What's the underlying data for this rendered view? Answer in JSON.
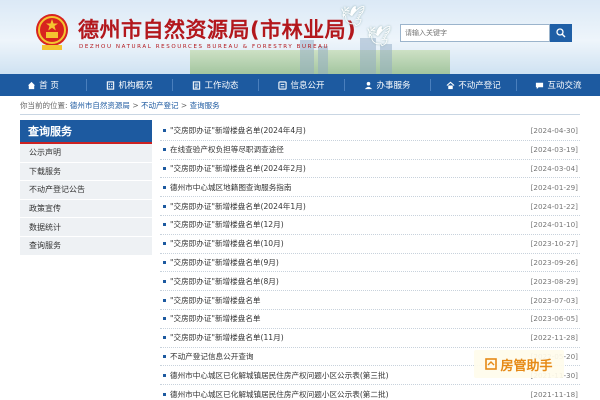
{
  "header": {
    "title": "德州市自然资源局(市林业局)",
    "subtitle": "DEZHOU NATURAL RESOURCES BUREAU & FORESTRY BUREAU",
    "search_placeholder": "请输入关键字"
  },
  "nav": {
    "items": [
      {
        "label": "首 页",
        "icon": "home-icon"
      },
      {
        "label": "机构概况",
        "icon": "building-icon"
      },
      {
        "label": "工作动态",
        "icon": "document-icon"
      },
      {
        "label": "信息公开",
        "icon": "info-list-icon"
      },
      {
        "label": "办事服务",
        "icon": "service-icon"
      },
      {
        "label": "不动产登记",
        "icon": "property-icon"
      },
      {
        "label": "互动交流",
        "icon": "chat-icon"
      }
    ]
  },
  "breadcrumb": {
    "prefix": "你当前的位置:",
    "items": [
      "德州市自然资源局",
      "不动产登记",
      "查询服务"
    ],
    "separator": ">"
  },
  "sidebar": {
    "title": "查询服务",
    "items": [
      "公示声明",
      "下载服务",
      "不动产登记公告",
      "政策宣传",
      "数据统计",
      "查询服务"
    ]
  },
  "list": {
    "rows": [
      {
        "title": "\"交房即办证\"新增楼盘名单(2024年4月)",
        "date": "[2024-04-30]"
      },
      {
        "title": "在线查验产权负担等尽职调查途径",
        "date": "[2024-03-19]"
      },
      {
        "title": "\"交房即办证\"新增楼盘名单(2024年2月)",
        "date": "[2024-03-04]"
      },
      {
        "title": "德州市中心城区地籍图查询服务指南",
        "date": "[2024-01-29]"
      },
      {
        "title": "\"交房即办证\"新增楼盘名单(2024年1月)",
        "date": "[2024-01-22]"
      },
      {
        "title": "\"交房即办证\"新增楼盘名单(12月)",
        "date": "[2024-01-10]"
      },
      {
        "title": "\"交房即办证\"新增楼盘名单(10月)",
        "date": "[2023-10-27]"
      },
      {
        "title": "\"交房即办证\"新增楼盘名单(9月)",
        "date": "[2023-09-26]"
      },
      {
        "title": "\"交房即办证\"新增楼盘名单(8月)",
        "date": "[2023-08-29]"
      },
      {
        "title": "\"交房即办证\"新增楼盘名单",
        "date": "[2023-07-03]"
      },
      {
        "title": "\"交房即办证\"新增楼盘名单",
        "date": "[2023-06-05]"
      },
      {
        "title": "\"交房即办证\"新增楼盘名单(11月)",
        "date": "[2022-11-28]"
      },
      {
        "title": "不动产登记信息公开查询",
        "date": "[2022-05-20]"
      },
      {
        "title": "德州市中心城区已化解城镇居民住房产权问题小区公示表(第三批)",
        "date": "[2021-11-30]"
      },
      {
        "title": "德州市中心城区已化解城镇居民住房产权问题小区公示表(第二批)",
        "date": "[2021-11-18]"
      }
    ]
  },
  "watermark": {
    "text": "房管助手",
    "icon": "house-mark-icon"
  },
  "colors": {
    "nav_blue": "#1d5aa0",
    "title_red": "#b3171c",
    "sidebar_bg": "#eef1f4",
    "watermark_orange": "#e68a17"
  }
}
